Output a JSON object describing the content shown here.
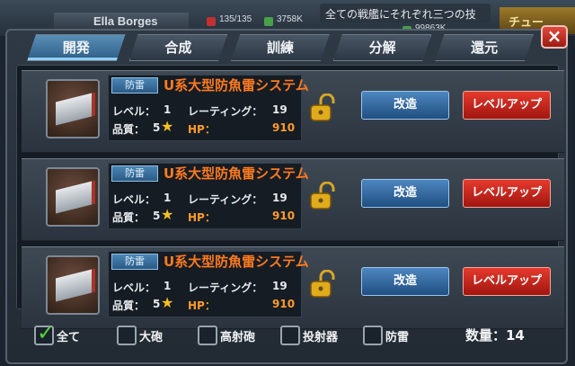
{
  "background": {
    "player_name": "Ella Borges",
    "stat1": "135/135",
    "stat2": "3758K",
    "stat3": "99863K",
    "ticker": "全ての戦艦にそれぞれ三つの技",
    "side_button": "チュー"
  },
  "tabs": [
    {
      "label": "開発",
      "active": true
    },
    {
      "label": "合成",
      "active": false
    },
    {
      "label": "訓練",
      "active": false
    },
    {
      "label": "分解",
      "active": false
    },
    {
      "label": "還元",
      "active": false
    }
  ],
  "close_label": "×",
  "cards": [
    {
      "category": "防雷",
      "name": "U系大型防魚雷システム",
      "level_label": "レベル：",
      "level": "1",
      "rating_label": "レーティング：",
      "rating": "19",
      "quality_label": "品質：",
      "quality": "5",
      "hp_label": "HP：",
      "hp": "910",
      "modify_label": "改造",
      "levelup_label": "レベルアップ"
    },
    {
      "category": "防雷",
      "name": "U系大型防魚雷システム",
      "level_label": "レベル：",
      "level": "1",
      "rating_label": "レーティング：",
      "rating": "19",
      "quality_label": "品質：",
      "quality": "5",
      "hp_label": "HP：",
      "hp": "910",
      "modify_label": "改造",
      "levelup_label": "レベルアップ"
    },
    {
      "category": "防雷",
      "name": "U系大型防魚雷システム",
      "level_label": "レベル：",
      "level": "1",
      "rating_label": "レーティング：",
      "rating": "19",
      "quality_label": "品質：",
      "quality": "5",
      "hp_label": "HP：",
      "hp": "910",
      "modify_label": "改造",
      "levelup_label": "レベルアップ"
    }
  ],
  "filters": [
    {
      "label": "全て",
      "checked": true
    },
    {
      "label": "大砲",
      "checked": false
    },
    {
      "label": "高射砲",
      "checked": false
    },
    {
      "label": "投射器",
      "checked": false
    },
    {
      "label": "防雷",
      "checked": false
    }
  ],
  "count_label": "数量：14",
  "colors": {
    "accent_orange": "#ff7a1f",
    "modify_blue": "#2f6aa0",
    "levelup_red": "#c8231a",
    "check_green": "#54d43a"
  }
}
